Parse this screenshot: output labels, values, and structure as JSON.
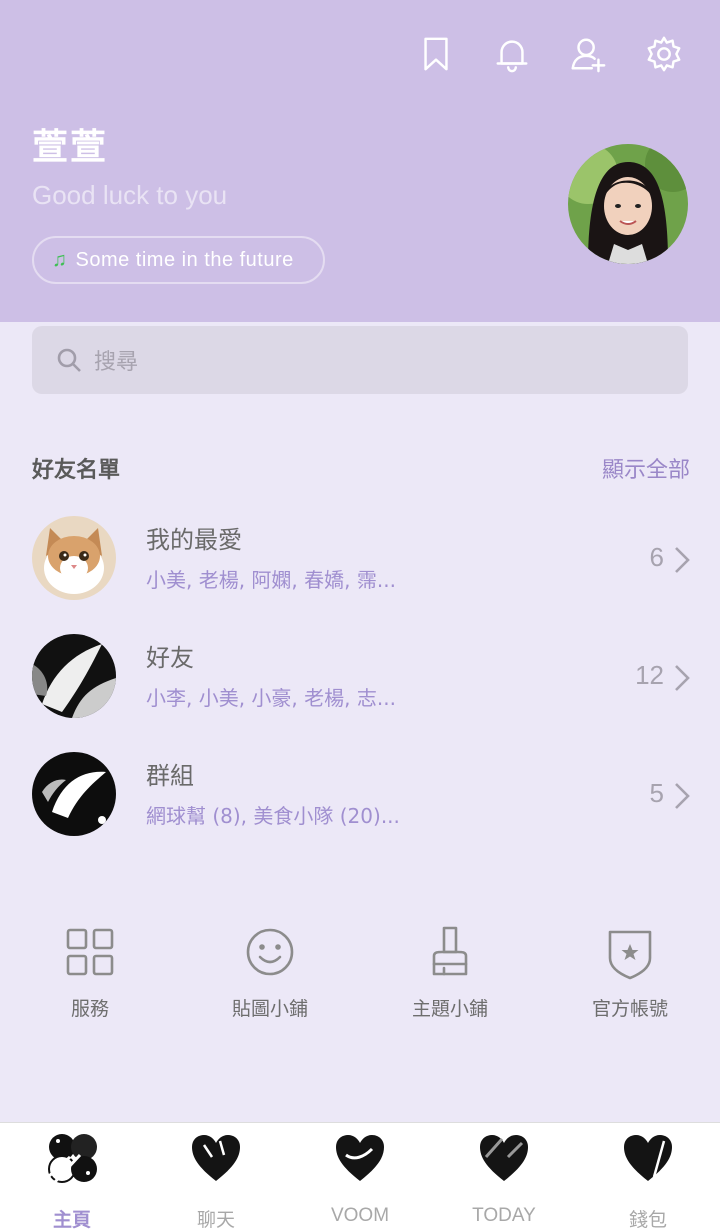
{
  "header": {
    "bg_color": "#CDBFE6",
    "icons": [
      "bookmark-icon",
      "bell-icon",
      "add-friend-icon",
      "gear-icon"
    ]
  },
  "profile": {
    "name": "萱萱",
    "status": "Good luck to you",
    "music": "Some time in the future"
  },
  "search": {
    "placeholder": "搜尋"
  },
  "friends": {
    "title": "好友名單",
    "show_all": "顯示全部",
    "rows": [
      {
        "title": "我的最愛",
        "members": "小美, 老楊, 阿嫻, 春嬌, 霈...",
        "count": "6"
      },
      {
        "title": "好友",
        "members": "小李, 小美, 小豪, 老楊, 志...",
        "count": "12"
      },
      {
        "title": "群組",
        "members": "網球幫 (8), 美食小隊 (20)...",
        "count": "5"
      }
    ]
  },
  "services": [
    {
      "label": "服務",
      "icon": "grid-icon"
    },
    {
      "label": "貼圖小鋪",
      "icon": "smiley-icon"
    },
    {
      "label": "主題小鋪",
      "icon": "brush-icon"
    },
    {
      "label": "官方帳號",
      "icon": "shield-star-icon"
    }
  ],
  "tabs": [
    {
      "label": "主頁",
      "active": true
    },
    {
      "label": "聊天",
      "active": false
    },
    {
      "label": "VOOM",
      "active": false
    },
    {
      "label": "TODAY",
      "active": false
    },
    {
      "label": "錢包",
      "active": false
    }
  ],
  "colors": {
    "accent": "#A08FD0",
    "background": "#ECE8F7",
    "music_note": "#3FBF55"
  }
}
